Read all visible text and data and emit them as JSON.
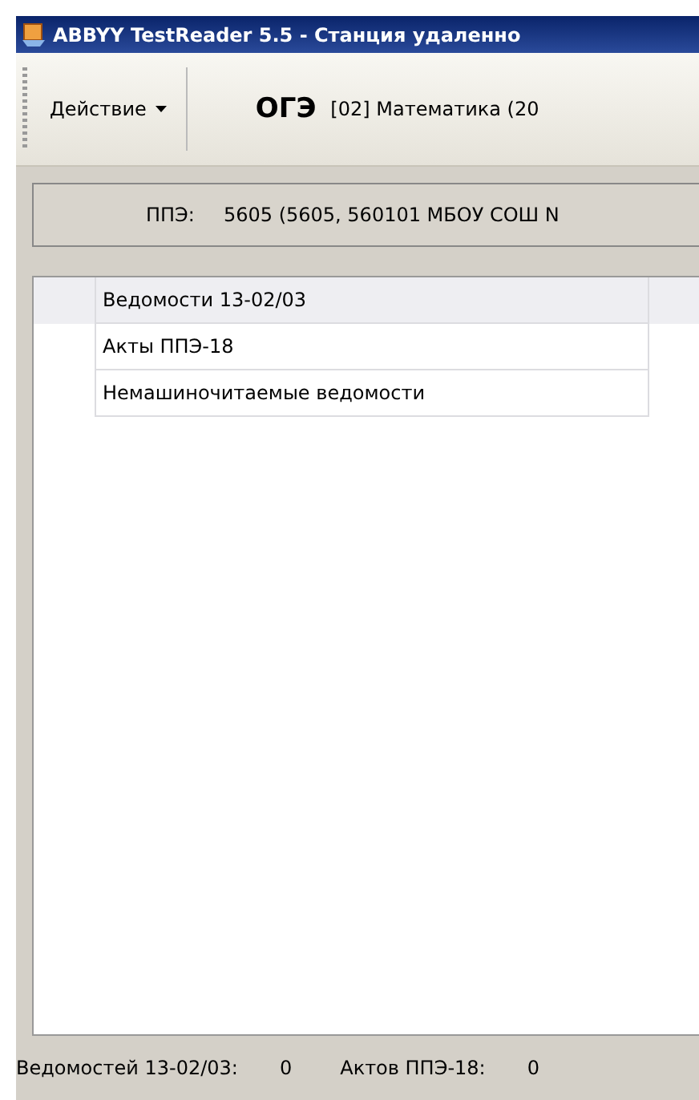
{
  "window": {
    "title": "ABBYY TestReader 5.5 - Станция удаленно"
  },
  "toolbar": {
    "action_menu": "Действие",
    "exam_type": "ОГЭ",
    "subject": "[02] Математика (20"
  },
  "info_panel": {
    "label": "ППЭ:",
    "value": "5605 (5605, 560101 МБОУ СОШ N"
  },
  "list": [
    {
      "label": "Ведомости 13-02/03",
      "selected": true
    },
    {
      "label": "Акты ППЭ-18",
      "selected": false
    },
    {
      "label": "Немашиночитаемые ведомости",
      "selected": false
    }
  ],
  "status_bar": [
    {
      "label": "Ведомостей 13-02/03:",
      "value": "0"
    },
    {
      "label": "Актов ППЭ-18:",
      "value": "0"
    }
  ]
}
